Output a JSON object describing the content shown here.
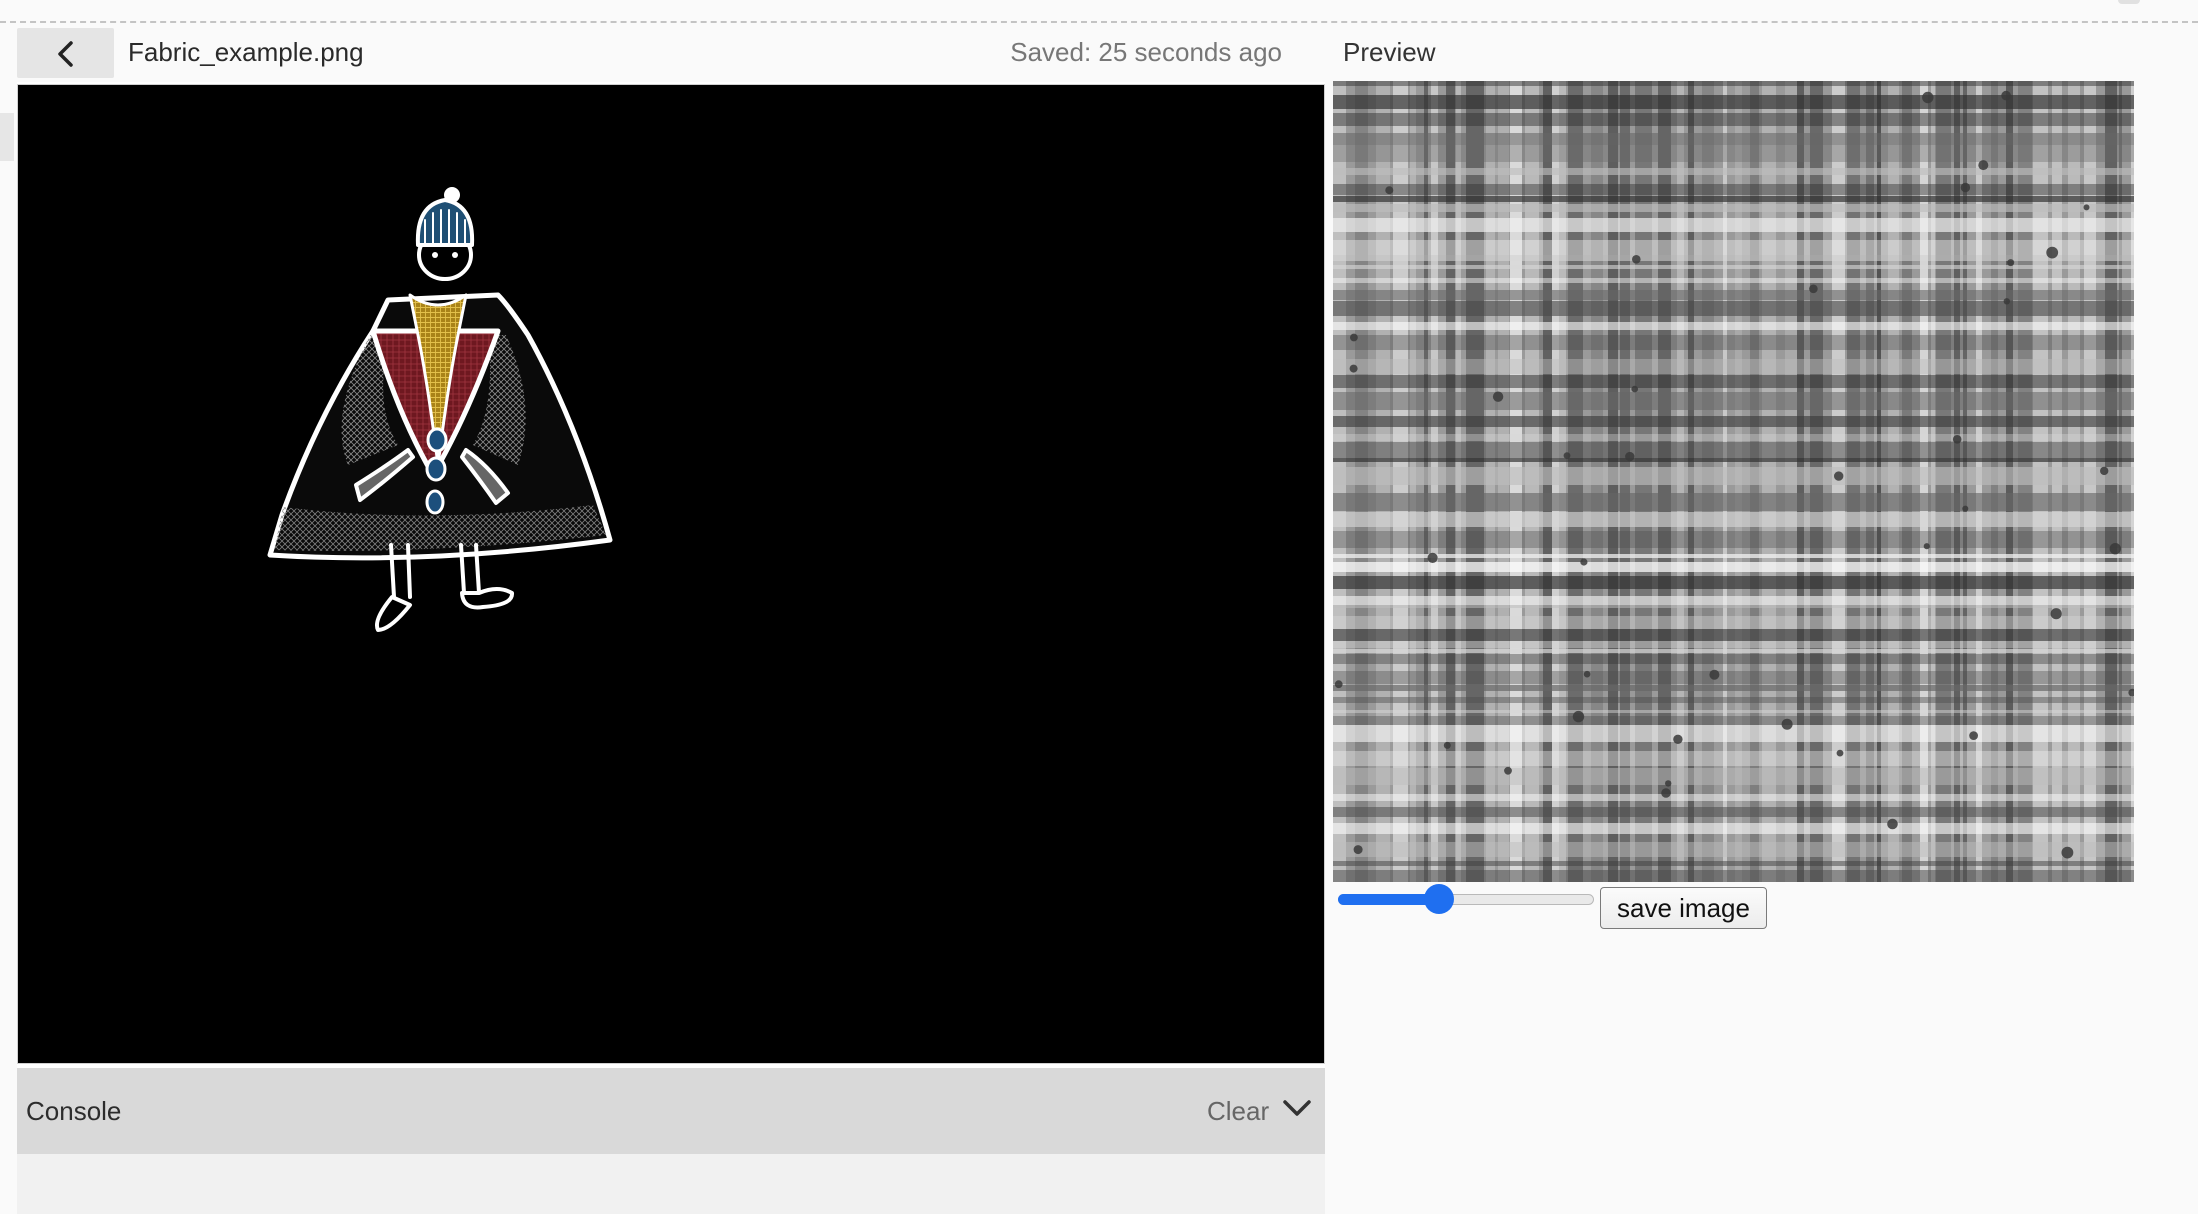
{
  "editor": {
    "filename": "Fabric_example.png",
    "saved_status": "Saved: 25 seconds ago",
    "back_icon": "chevron-left-icon"
  },
  "console": {
    "label": "Console",
    "clear_label": "Clear",
    "toggle_icon": "chevron-down-icon"
  },
  "preview": {
    "title": "Preview",
    "slider_value": 0.38,
    "save_label": "save image"
  },
  "colors": {
    "accent": "#1f6ff0",
    "canvas_bg": "#000000",
    "coat_collar": "#7f1d26",
    "scarf": "#c9a228",
    "hat": "#1f4f74",
    "buttons": "#1c4f7c"
  }
}
